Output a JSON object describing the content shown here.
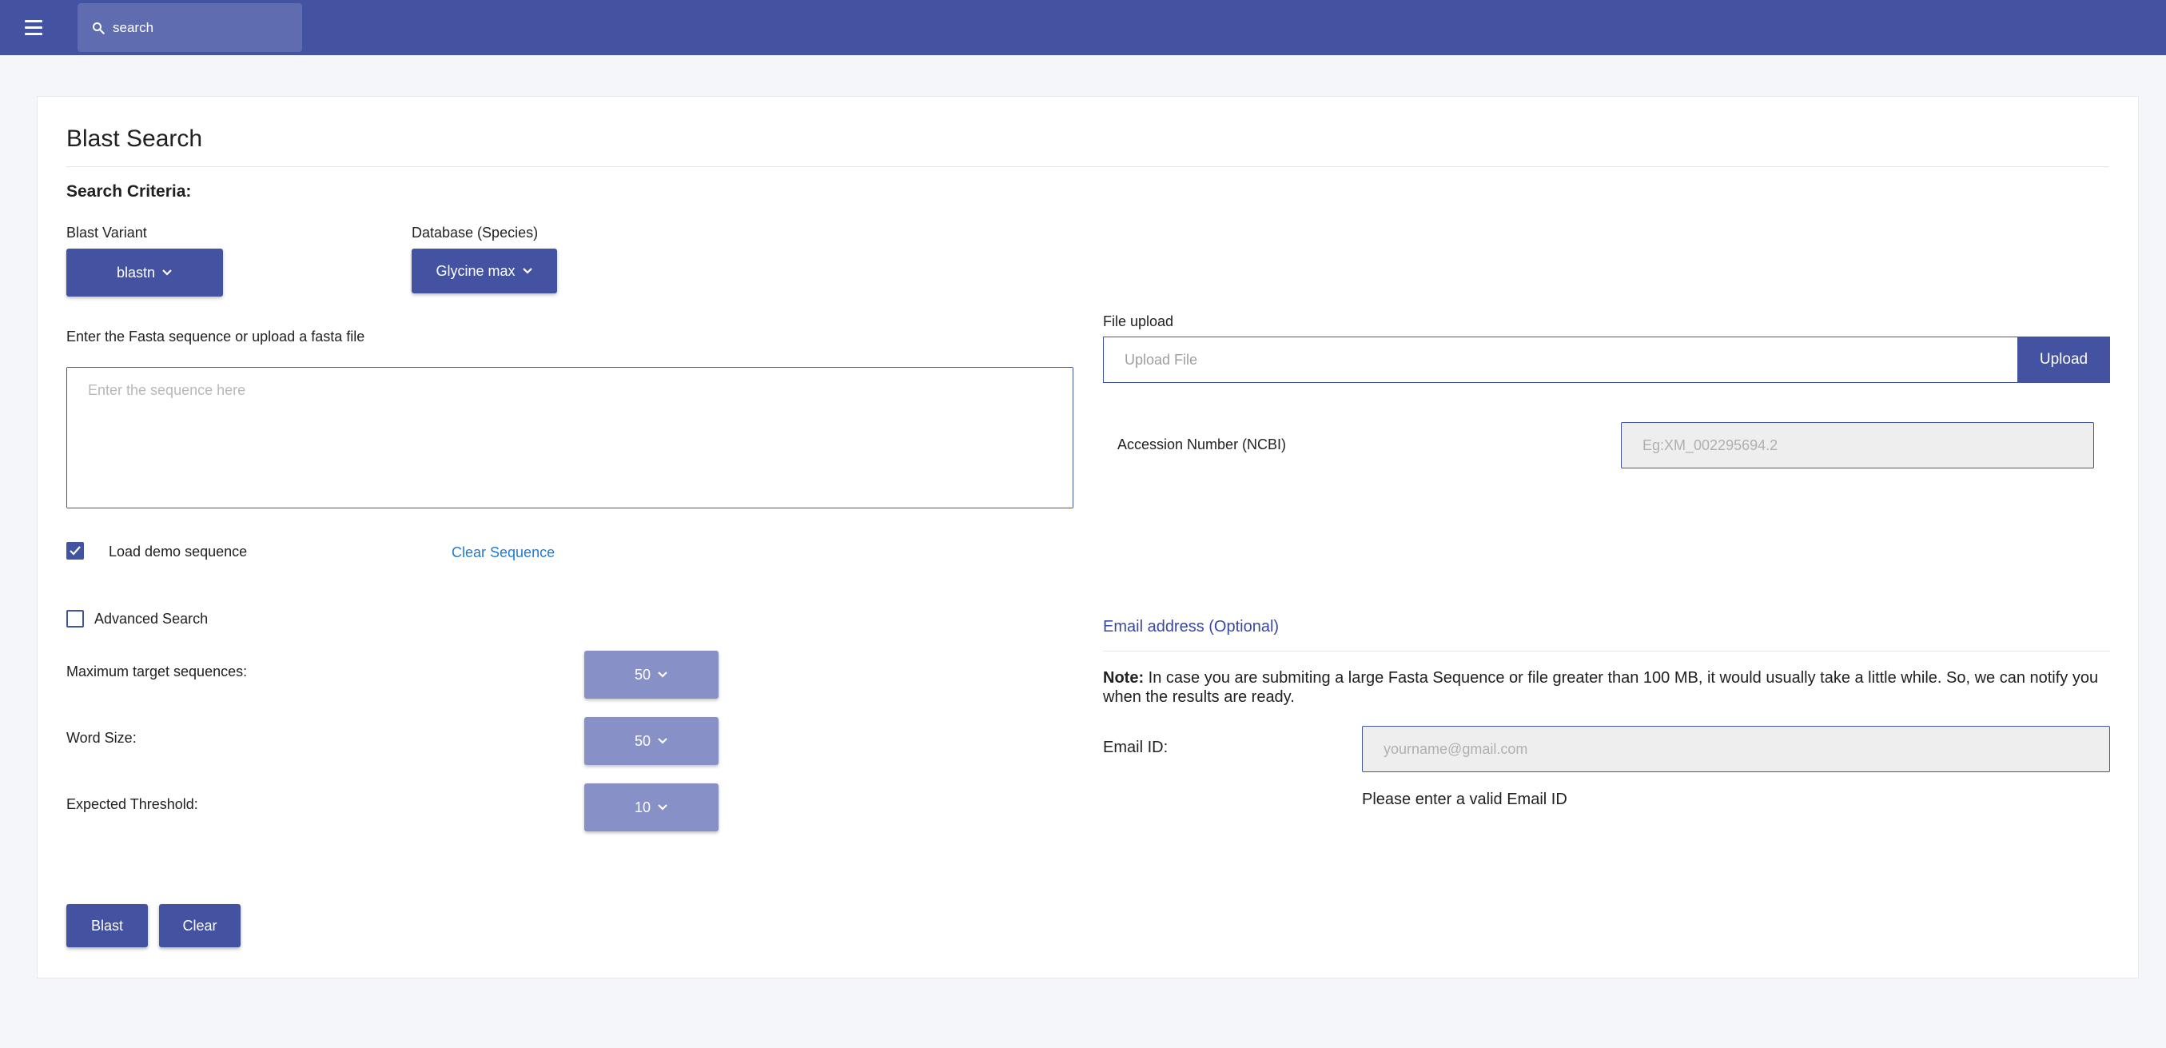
{
  "header": {
    "search_placeholder": "search"
  },
  "page": {
    "title": "Blast Search",
    "criteria_label": "Search Criteria:"
  },
  "blast_variant": {
    "label": "Blast Variant",
    "value": "blastn"
  },
  "database": {
    "label": "Database (Species)",
    "value": "Glycine max"
  },
  "sequence": {
    "label": "Enter the Fasta sequence or upload a fasta file",
    "placeholder": "Enter the sequence here",
    "value": ""
  },
  "demo": {
    "label": "Load demo sequence",
    "checked": true
  },
  "clear_sequence_label": "Clear Sequence",
  "file_upload": {
    "label": "File upload",
    "placeholder": "Upload File",
    "button_label": "Upload"
  },
  "accession": {
    "label": "Accession Number (NCBI)",
    "placeholder": "Eg:XM_002295694.2"
  },
  "advanced": {
    "label": "Advanced Search",
    "checked": false,
    "max_target": {
      "label": "Maximum target sequences:",
      "value": "50"
    },
    "word_size": {
      "label": "Word Size:",
      "value": "50"
    },
    "threshold": {
      "label": "Expected Threshold:",
      "value": "10"
    }
  },
  "email": {
    "section_title": "Email address (Optional)",
    "note_bold": "Note:",
    "note_text": "In case you are submiting a large Fasta Sequence or file greater than 100 MB, it would usually take a little while. So, we can notify you when the results are ready.",
    "field_label": "Email ID:",
    "placeholder": "yourname@gmail.com",
    "validation_message": "Please enter a valid Email ID"
  },
  "actions": {
    "blast_label": "Blast",
    "clear_label": "Clear"
  },
  "colors": {
    "primary": "#4352a1",
    "primary_light": "#8890c8",
    "link": "#1f7ad6"
  }
}
